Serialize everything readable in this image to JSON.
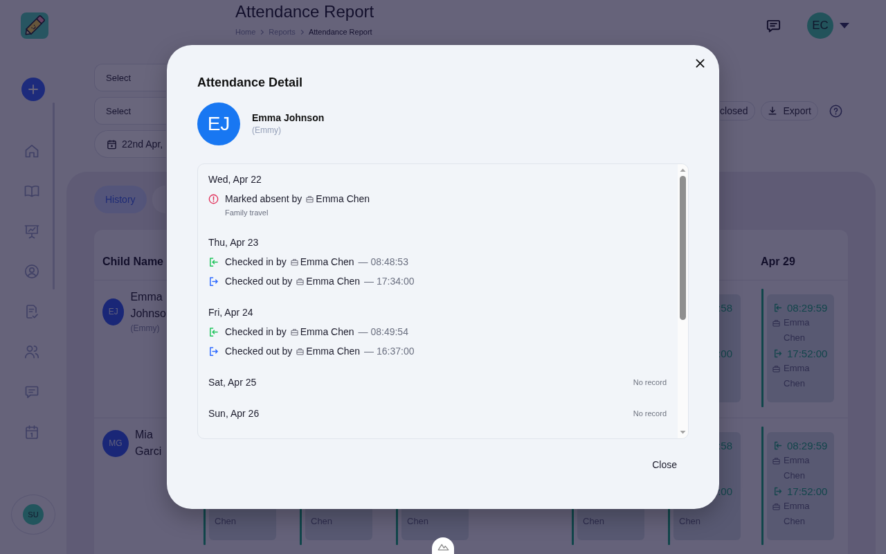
{
  "sidebar": {
    "user_initials": "SU"
  },
  "header": {
    "title": "Attendance Report",
    "breadcrumb": [
      {
        "label": "Home",
        "current": false
      },
      {
        "label": "Reports",
        "current": false
      },
      {
        "label": "Attendance Report",
        "current": true
      }
    ],
    "user_initials": "EC"
  },
  "filters": {
    "selects": [
      {
        "placeholder": "Select"
      },
      {
        "placeholder": "Select"
      }
    ],
    "date_range": "22nd Apr,",
    "status_button": "closed",
    "export_button": "Export"
  },
  "tabs": [
    {
      "label": "History",
      "selected": true
    },
    {
      "selected": false
    }
  ],
  "table": {
    "name_column": "Child Name",
    "day_columns": [
      "",
      "",
      "",
      "",
      "",
      "",
      "Apr 29"
    ],
    "rows": [
      {
        "initials": "EJ",
        "name": "Emma Johnso",
        "nickname": "(Emmy)",
        "cells": [
          "",
          "",
          "",
          "",
          "",
          {
            "kind": "partial",
            "in_time": ":58",
            "out_time": ":00"
          },
          {
            "kind": "full",
            "in_time": "08:29:59",
            "in_by": "Emma Chen",
            "out_time": "17:52:00",
            "out_by": "Emma Chen"
          }
        ]
      },
      {
        "initials": "MG",
        "name": "Mia Garci",
        "cells": [
          {
            "kind": "partial",
            "out_by": "Chen"
          },
          {
            "kind": "partial",
            "out_by": "Chen"
          },
          {
            "kind": "partial",
            "out_by": "Chen"
          },
          "",
          {
            "kind": "partial",
            "out_by": "Chen"
          },
          {
            "kind": "partial",
            "in_time": ":58",
            "out_time": ":00",
            "out_by": "Chen"
          },
          {
            "kind": "full",
            "in_time": "08:29:59",
            "in_by": "Emma Chen",
            "out_time": "17:52:00",
            "out_by": "Emma Chen"
          }
        ]
      }
    ]
  },
  "dialog": {
    "title": "Attendance Detail",
    "child": {
      "initials": "EJ",
      "name": "Emma Johnson",
      "nickname": "(Emmy)"
    },
    "days": [
      {
        "date": "Wed, Apr 22",
        "events": [
          {
            "kind": "absent",
            "action": "Marked absent by",
            "staff": "Emma Chen",
            "note": "Family travel"
          }
        ]
      },
      {
        "date": "Thu, Apr 23",
        "events": [
          {
            "kind": "check_in",
            "action": "Checked in by",
            "staff": "Emma Chen",
            "time": "— 08:48:53"
          },
          {
            "kind": "check_out",
            "action": "Checked out by",
            "staff": "Emma Chen",
            "time": "— 17:34:00"
          }
        ]
      },
      {
        "date": "Fri, Apr 24",
        "events": [
          {
            "kind": "check_in",
            "action": "Checked in by",
            "staff": "Emma Chen",
            "time": "— 08:49:54"
          },
          {
            "kind": "check_out",
            "action": "Checked out by",
            "staff": "Emma Chen",
            "time": "— 16:37:00"
          }
        ]
      },
      {
        "date": "Sat, Apr 25",
        "status": "No record"
      },
      {
        "date": "Sun, Apr 26",
        "status": "No record"
      }
    ],
    "close_button": "Close"
  }
}
